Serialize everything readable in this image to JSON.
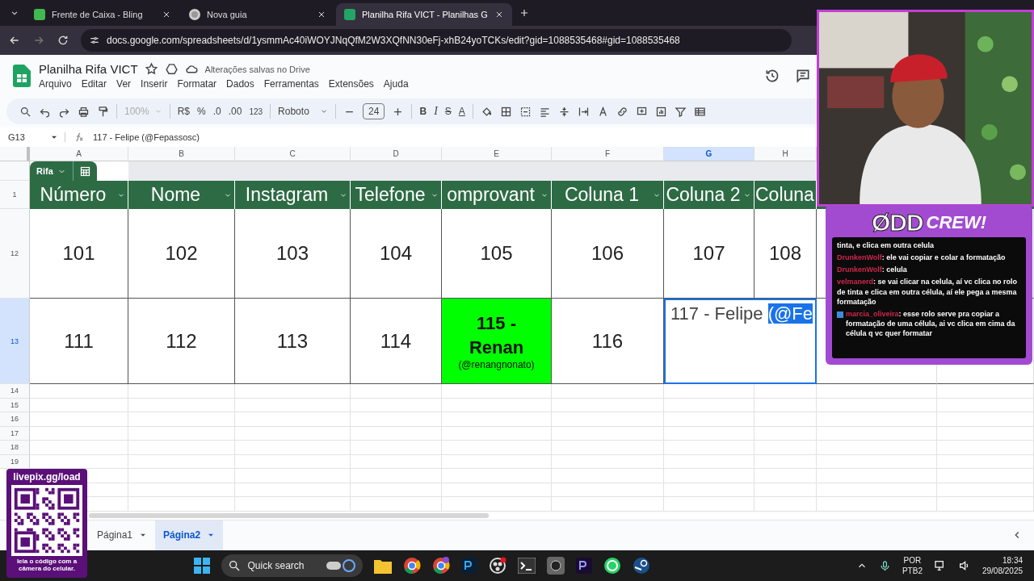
{
  "browser": {
    "tabs": [
      {
        "title": "Frente de Caixa - Bling",
        "selected": false,
        "kind": "bling"
      },
      {
        "title": "Nova guia",
        "selected": false,
        "kind": "chrome"
      },
      {
        "title": "Planilha Rifa VICT - Planilhas G",
        "selected": true,
        "kind": "sheets"
      }
    ],
    "url": "docs.google.com/spreadsheets/d/1ysmmAc40iWOYJNqQfM2W3XQfNN30eFj-xhB24yoTCKs/edit?gid=1088535468#gid=1088535468"
  },
  "document": {
    "title": "Planilha Rifa VICT",
    "save_status": "Alterações salvas no Drive",
    "menu": [
      "Arquivo",
      "Editar",
      "Ver",
      "Inserir",
      "Formatar",
      "Dados",
      "Ferramentas",
      "Extensões",
      "Ajuda"
    ]
  },
  "toolbar": {
    "zoom": "100%",
    "currency": "R$",
    "percent": "%",
    "decrease_decimal": ".0",
    "increase_decimal": ".00",
    "number_format": "123",
    "font": "Roboto",
    "font_size": "24",
    "bold": "B",
    "italic": "I",
    "strikethrough": "S",
    "text_color": "A"
  },
  "formula_bar": {
    "cell_ref": "G13",
    "formula": "117 - Felipe (@Fepassosc)"
  },
  "columns": [
    {
      "label": "A",
      "selected": false
    },
    {
      "label": "B",
      "selected": false
    },
    {
      "label": "C",
      "selected": false
    },
    {
      "label": "D",
      "selected": false
    },
    {
      "label": "E",
      "selected": false
    },
    {
      "label": "F",
      "selected": false
    },
    {
      "label": "G",
      "selected": true
    },
    {
      "label": "H",
      "selected": false
    }
  ],
  "table": {
    "name": "Rifa",
    "row_number": "1",
    "headers": [
      "Número",
      "Nome",
      "Instagram",
      "Telefone",
      "omprovant",
      "Coluna 1",
      "Coluna 2",
      "Coluna"
    ]
  },
  "rows": [
    {
      "number": "12",
      "selected": false,
      "cells": [
        {
          "text": "101"
        },
        {
          "text": "102"
        },
        {
          "text": "103"
        },
        {
          "text": "104"
        },
        {
          "text": "105"
        },
        {
          "text": "106"
        },
        {
          "text": "107"
        },
        {
          "text": "108"
        }
      ]
    },
    {
      "number": "13",
      "selected": true,
      "cells": [
        {
          "text": "111"
        },
        {
          "text": "112"
        },
        {
          "text": "113"
        },
        {
          "text": "114"
        },
        {
          "kind": "highlight",
          "color": "#00ff00",
          "text": "115 - Renan",
          "subtitle": "(@renangnonato)"
        },
        {
          "text": "116"
        },
        {
          "kind": "editing",
          "text": "117 - Felipe",
          "selected_text": "(@Fe"
        }
      ]
    }
  ],
  "empty_rows": [
    "14",
    "15",
    "16",
    "17",
    "18",
    "19"
  ],
  "sheets": [
    {
      "name": "Página1",
      "selected": false
    },
    {
      "name": "Página2",
      "selected": true
    }
  ],
  "chat": {
    "messages": [
      {
        "text": "tinta, e clica em outra celula"
      },
      {
        "user": "DrunkenWolf",
        "text": ": ele vai copiar e colar a formatação"
      },
      {
        "user": "DrunkenWolf",
        "text": ": celula"
      },
      {
        "user": "velmanerd",
        "text": ": se vai clicar na celula, aí vc clica no rolo de tinta e clica em outra célula, aí ele pega a mesma formatação"
      },
      {
        "user": "marcia_oliveira",
        "badge": true,
        "text": ": esse rolo serve pra copiar a formatação de uma célula, ai vc clica em cima da célula q vc quer formatar"
      }
    ]
  },
  "overlay": {
    "logo_left": "ØDD",
    "logo_right": "CREW!",
    "qr_url": "livepix.gg/load",
    "qr_caption": "leia o código com a câmera do celular."
  },
  "webcam": {
    "kind": "picture"
  },
  "taskbar": {
    "search": "Quick search",
    "language": "POR",
    "layout": "PTB2",
    "time": "18:34",
    "date": "29/08/2025"
  }
}
